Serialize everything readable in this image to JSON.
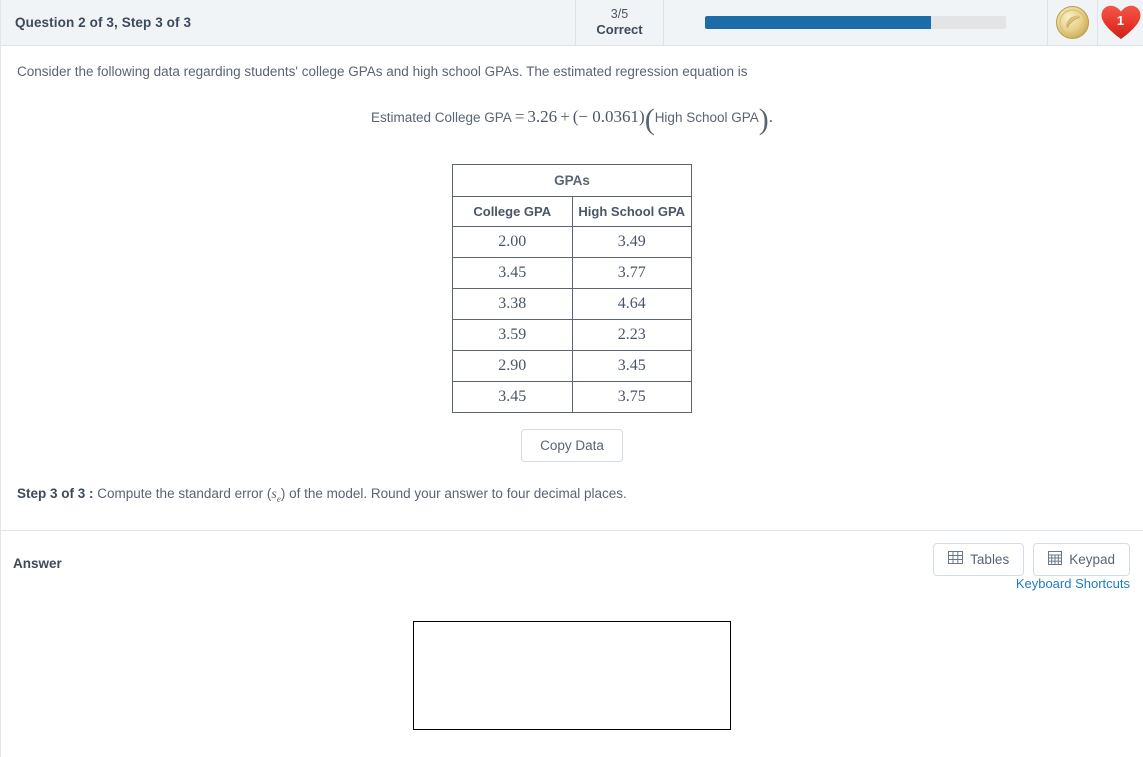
{
  "header": {
    "title": "Question 2 of 3, Step 3 of 3",
    "score_fraction": "3/5",
    "score_label": "Correct",
    "progress_percent": 75,
    "progress_fill_color": "#1b6ca8",
    "progress_track_color": "#e2e4e6",
    "coin_icon": "coin-icon",
    "life_icon": "heart-icon",
    "life_count": "1"
  },
  "question": {
    "intro": "Consider the following data regarding students' college GPAs and high school GPAs. The estimated regression equation is",
    "equation": {
      "lhs": "Estimated College GPA",
      "equals": "=",
      "intercept": "3.26",
      "plus": "+",
      "open_paren": "(",
      "slope": "− 0.0361",
      "close_paren": ")",
      "variable": "High School GPA",
      "period": "."
    },
    "step_label": "Step 3 of 3 :",
    "step_text_before": "Compute the standard error (",
    "step_symbol": "s",
    "step_symbol_sub": "e",
    "step_text_after": ") of the model. Round your answer to four decimal places."
  },
  "table": {
    "caption": "GPAs",
    "columns": [
      "College GPA",
      "High School GPA"
    ],
    "rows": [
      [
        "2.00",
        "3.49"
      ],
      [
        "3.45",
        "3.77"
      ],
      [
        "3.38",
        "4.64"
      ],
      [
        "3.59",
        "2.23"
      ],
      [
        "2.90",
        "3.45"
      ],
      [
        "3.45",
        "3.75"
      ]
    ],
    "copy_button": "Copy Data"
  },
  "answer": {
    "label": "Answer",
    "tables_button": "Tables",
    "keypad_button": "Keypad",
    "keyboard_shortcuts_link": "Keyboard Shortcuts",
    "input_value": "",
    "input_placeholder": ""
  }
}
